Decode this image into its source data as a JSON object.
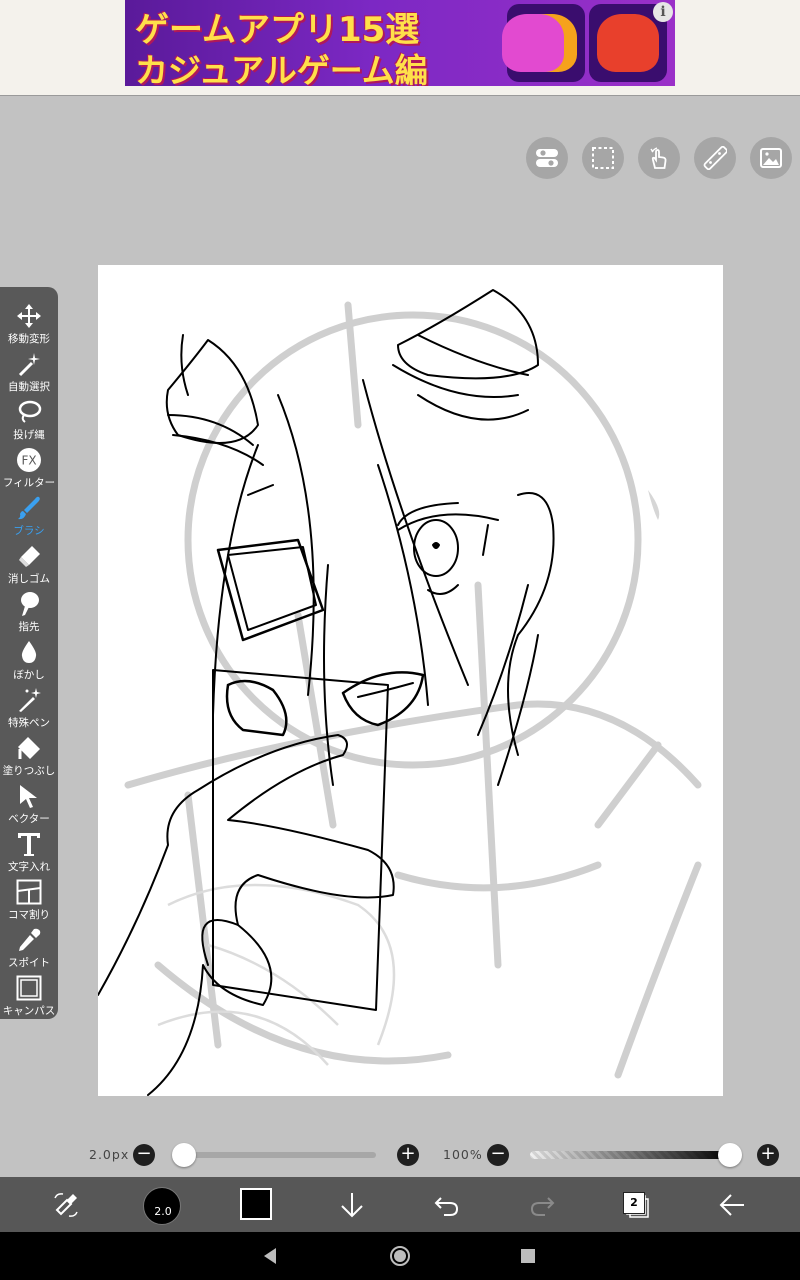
{
  "ad": {
    "line1": "ゲームアプリ15選",
    "line2": "カジュアルゲーム編",
    "info_glyph": "i",
    "icons": [
      "orange-jelly-icon",
      "pink-jelly-icon",
      "red-jelly-icon"
    ]
  },
  "top_tools": [
    {
      "name": "toggle-settings-icon"
    },
    {
      "name": "selection-icon"
    },
    {
      "name": "hand-gesture-icon"
    },
    {
      "name": "ruler-icon"
    },
    {
      "name": "image-material-icon"
    }
  ],
  "toolbar": {
    "active_index": 4,
    "active_color": "#3aa0f0",
    "items": [
      {
        "label": "移動変形",
        "icon": "move-icon"
      },
      {
        "label": "自動選択",
        "icon": "magic-wand-icon"
      },
      {
        "label": "投げ縄",
        "icon": "lasso-icon"
      },
      {
        "label": "フィルター",
        "icon": "fx-icon"
      },
      {
        "label": "ブラシ",
        "icon": "brush-icon"
      },
      {
        "label": "消しゴム",
        "icon": "eraser-icon"
      },
      {
        "label": "指先",
        "icon": "finger-smudge-icon"
      },
      {
        "label": "ぼかし",
        "icon": "blur-drop-icon"
      },
      {
        "label": "特殊ペン",
        "icon": "special-pen-icon"
      },
      {
        "label": "塗りつぶし",
        "icon": "fill-bucket-icon"
      },
      {
        "label": "ベクター",
        "icon": "vector-cursor-icon"
      },
      {
        "label": "文字入れ",
        "icon": "text-icon"
      },
      {
        "label": "コマ割り",
        "icon": "frame-divider-icon"
      },
      {
        "label": "スポイト",
        "icon": "eyedropper-icon"
      },
      {
        "label": "キャンパス",
        "icon": "canvas-icon"
      }
    ]
  },
  "brush": {
    "size_label": "2.0px",
    "size_fraction": 0.02,
    "opacity_label": "100%",
    "opacity_fraction": 1.0
  },
  "bottom_bar": {
    "brush_size": "2.0",
    "color": "#000000",
    "layer_count": "2"
  },
  "buttons": {
    "minus": "−",
    "plus": "+"
  }
}
